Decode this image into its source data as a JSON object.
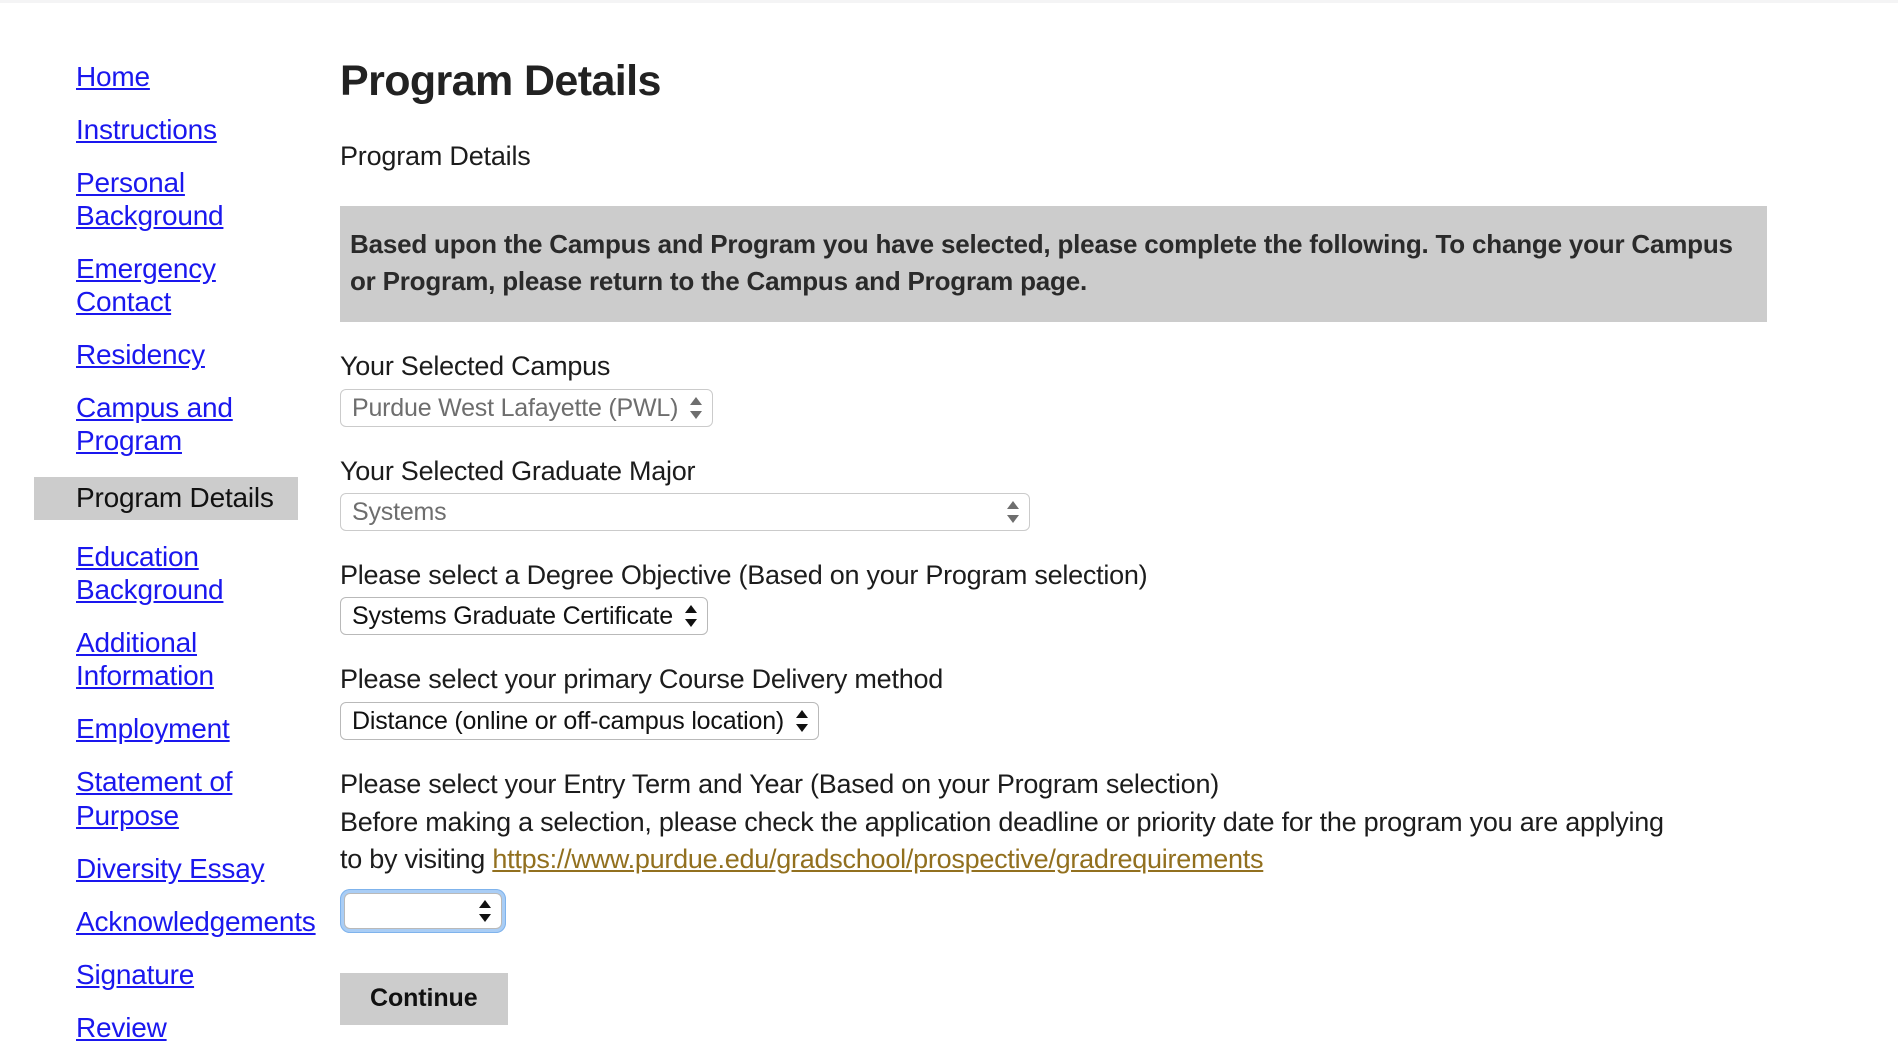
{
  "sidebar": {
    "items": [
      {
        "label": "Home",
        "current": false
      },
      {
        "label": "Instructions",
        "current": false
      },
      {
        "label": "Personal Background",
        "current": false
      },
      {
        "label": "Emergency Contact",
        "current": false
      },
      {
        "label": "Residency",
        "current": false
      },
      {
        "label": "Campus and Program",
        "current": false
      },
      {
        "label": "Program Details",
        "current": true
      },
      {
        "label": "Education Background",
        "current": false
      },
      {
        "label": "Additional Information",
        "current": false
      },
      {
        "label": "Employment",
        "current": false
      },
      {
        "label": "Statement of Purpose",
        "current": false
      },
      {
        "label": "Diversity Essay",
        "current": false
      },
      {
        "label": "Acknowledgements",
        "current": false
      },
      {
        "label": "Signature",
        "current": false
      },
      {
        "label": "Review",
        "current": false
      }
    ]
  },
  "main": {
    "title": "Program Details",
    "subtitle": "Program Details",
    "notice": "Based upon the Campus and Program you have selected, please complete the following. To change your Campus or Program, please return to the Campus and Program page.",
    "fields": {
      "campus": {
        "label": "Your Selected Campus",
        "value": "Purdue West Lafayette (PWL)",
        "disabled": true
      },
      "major": {
        "label": "Your Selected Graduate Major",
        "value": "Systems",
        "disabled": true
      },
      "degree_objective": {
        "label": "Please select a Degree Objective (Based on your Program selection)",
        "value": "Systems Graduate Certificate",
        "disabled": false
      },
      "delivery": {
        "label": "Please select your primary Course Delivery method",
        "value": "Distance (online or off-campus location)",
        "disabled": false
      },
      "entry_term": {
        "label_line1": "Please select your Entry Term and Year (Based on your Program selection)",
        "label_line2a": "Before making a selection, please check the application deadline or priority date for the program you are applying",
        "label_line2b": "to by visiting ",
        "link_text": "https://www.purdue.edu/gradschool/prospective/gradrequirements",
        "value": "",
        "focused": true
      }
    },
    "continue_label": "Continue"
  },
  "colors": {
    "link_blue": "#1a17ee",
    "link_gold": "#92701f",
    "highlight_gray": "#cccccc",
    "focus_ring_blue": "#a9cdf5"
  }
}
